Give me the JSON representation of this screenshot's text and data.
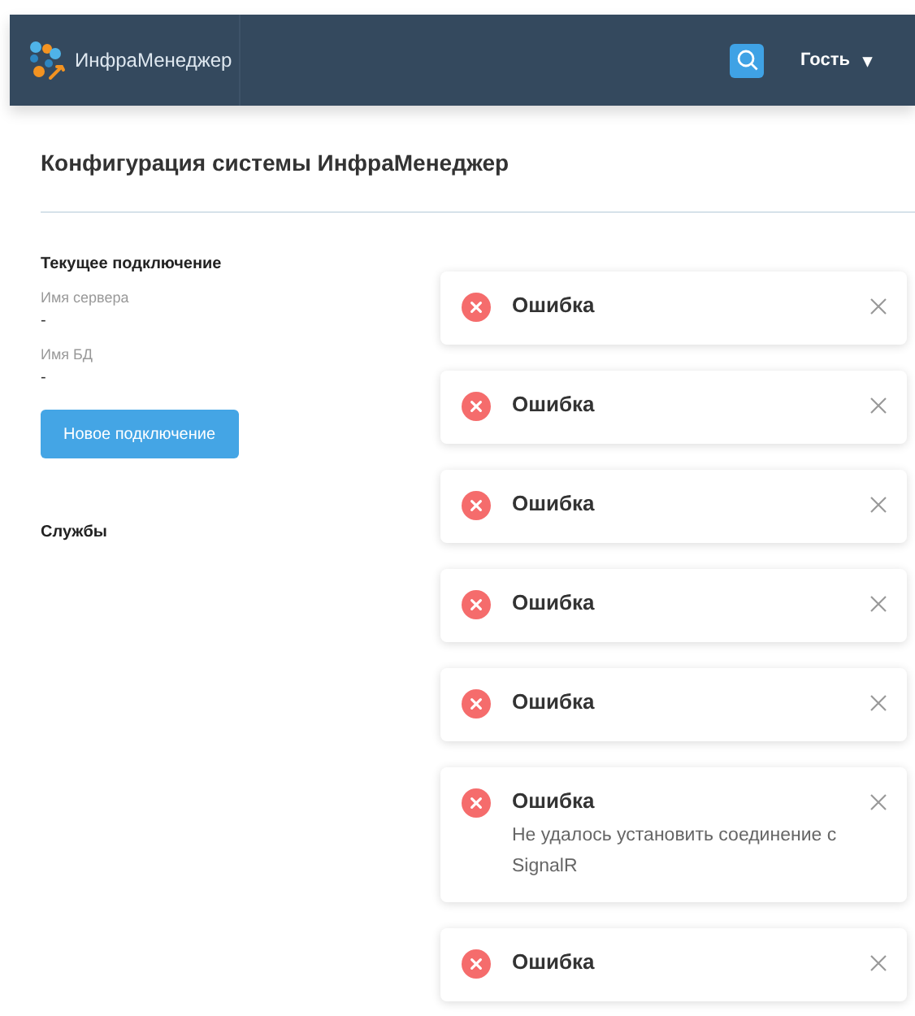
{
  "header": {
    "app_name": "ИнфраМенеджер",
    "user": "Гость",
    "user_caret": "▾"
  },
  "page": {
    "title": "Конфигурация системы ИнфраМенеджер"
  },
  "connection": {
    "heading": "Текущее подключение",
    "fields": [
      {
        "label": "Имя сервера",
        "value": "-"
      },
      {
        "label": "Имя БД",
        "value": "-"
      }
    ],
    "button": "Новое подключение"
  },
  "services": {
    "heading": "Службы"
  },
  "notifications": [
    {
      "title": "Ошибка"
    },
    {
      "title": "Ошибка"
    },
    {
      "title": "Ошибка"
    },
    {
      "title": "Ошибка"
    },
    {
      "title": "Ошибка"
    },
    {
      "title": "Ошибка",
      "message": "Не удалось установить соединение с SignalR"
    },
    {
      "title": "Ошибка"
    }
  ]
}
